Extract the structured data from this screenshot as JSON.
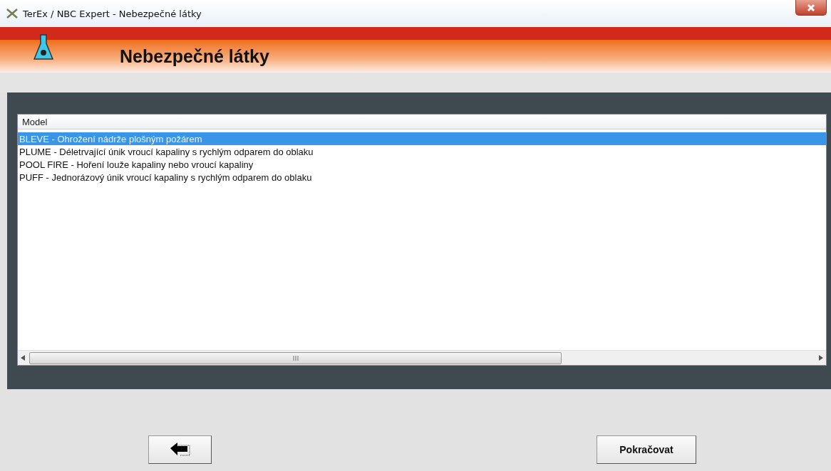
{
  "window": {
    "title": "TerEx / NBC Expert  - Nebezpečné látky"
  },
  "header": {
    "title": "Nebezpečné látky"
  },
  "list": {
    "columns": [
      "Model"
    ],
    "rows": [
      {
        "label": "BLEVE - Ohrožení nádrže plošným požárem",
        "selected": true
      },
      {
        "label": "PLUME - Déletrvající únik vroucí kapaliny s rychlým odparem do oblaku",
        "selected": false
      },
      {
        "label": "POOL FIRE - Hoření louže kapaliny nebo vroucí kapaliny",
        "selected": false
      },
      {
        "label": "PUFF - Jednorázový únik vroucí kapaliny s rychlým odparem do oblaku",
        "selected": false
      }
    ]
  },
  "buttons": {
    "continue": "Pokračovat"
  }
}
